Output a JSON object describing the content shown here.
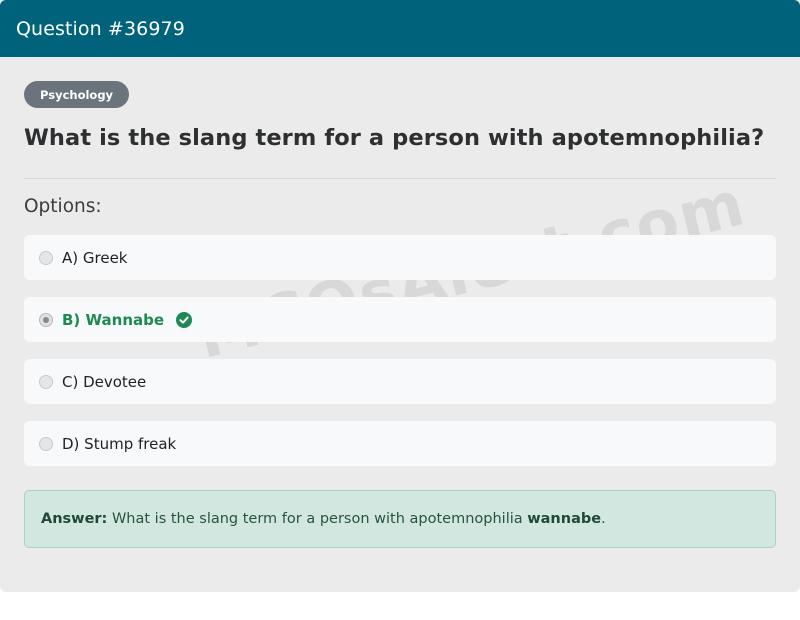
{
  "header": {
    "title": "Question #36979"
  },
  "category_badge": "Psychology",
  "question": "What is the slang term for a person with apotemnophilia?",
  "options_heading": "Options:",
  "options": [
    {
      "label": "A) Greek",
      "selected": false,
      "correct": false
    },
    {
      "label": "B) Wannabe",
      "selected": true,
      "correct": true
    },
    {
      "label": "C) Devotee",
      "selected": false,
      "correct": false
    },
    {
      "label": "D) Stump freak",
      "selected": false,
      "correct": false
    }
  ],
  "answer": {
    "prefix": "Answer:",
    "text": "What is the slang term for a person with apotemnophilia",
    "value": "wannabe",
    "suffix": "."
  },
  "watermark": "MCQsAlert.com",
  "colors": {
    "header_bg": "#00637b",
    "correct": "#1c8a52",
    "answer_bg": "#d2e7df",
    "badge_bg": "#6b747c"
  },
  "icons": {
    "correct_marker": "check-circle-icon"
  }
}
